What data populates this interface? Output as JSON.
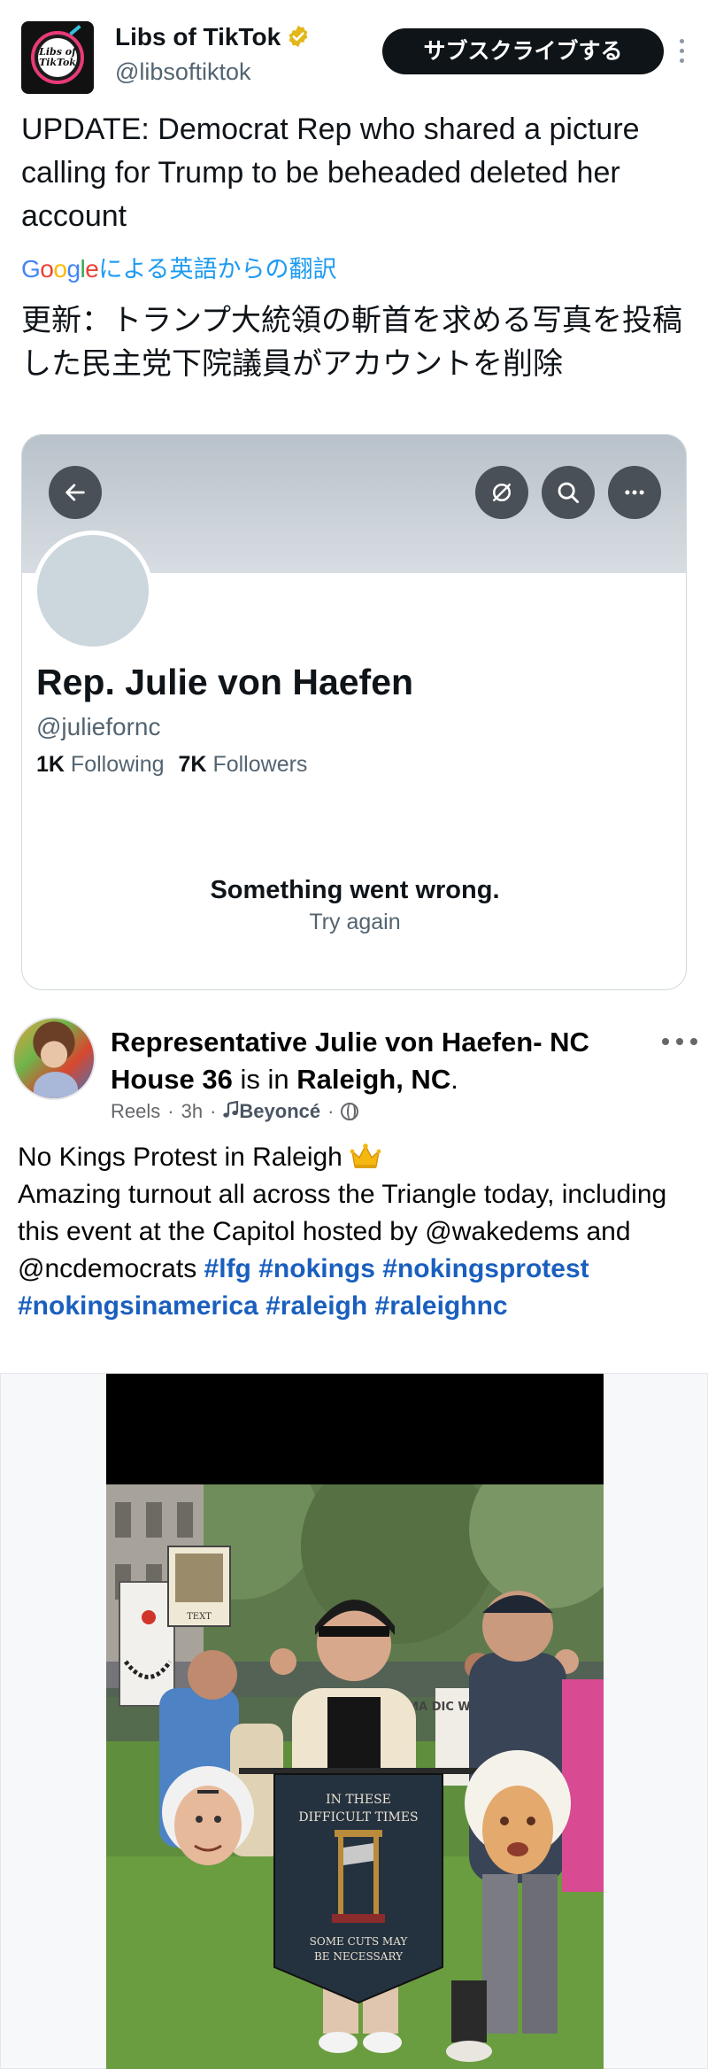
{
  "tweet": {
    "author_name": "Libs of TikTok",
    "author_handle": "@libsoftiktok",
    "avatar_text_line1": "Libs of",
    "avatar_text_line2": "TikTok",
    "subscribe_label": "サブスクライブする",
    "text": "UPDATE: Democrat Rep who shared a picture calling for Trump to be beheaded deleted her account",
    "translation": {
      "google_letters": [
        "G",
        "o",
        "o",
        "g",
        "l",
        "e"
      ],
      "label": "による英語からの翻訳",
      "text": "更新：トランプ大統領の斬首を求める写真を投稿した民主党下院議員がアカウントを削除"
    },
    "icons": [
      "verified-badge-icon",
      "more-vertical-icon"
    ]
  },
  "profile_card": {
    "name": "Rep. Julie von Haefen",
    "handle": "@juliefornc",
    "following_count": "1K",
    "following_label": "Following",
    "followers_count": "7K",
    "followers_label": "Followers",
    "error_title": "Something went wrong.",
    "error_retry": "Try again",
    "icons": [
      "back-arrow-icon",
      "notifications-off-icon",
      "search-icon",
      "more-horizontal-icon"
    ]
  },
  "facebook_post": {
    "author": "Representative Julie von Haefen- NC House 36",
    "is_in": "is in",
    "location": "Raleigh, NC",
    "period": ".",
    "meta_type": "Reels",
    "meta_time": "3h",
    "meta_music": "Beyoncé",
    "body_line1": "No Kings Protest in Raleigh",
    "body_text": "Amazing turnout all across the Triangle today, including this event at the Capitol hosted by @wakedems and @ncdemocrats",
    "hashtags": [
      "#lfg",
      "#nokings",
      "#nokingsprotest",
      "#nokingsinamerica",
      "#raleigh",
      "#raleighnc"
    ],
    "icons": [
      "crown-emoji-icon",
      "music-note-icon",
      "globe-icon",
      "more-horizontal-icon"
    ]
  },
  "video": {
    "banner_line1": "IN THESE",
    "banner_line2": "DIFFICULT TIMES",
    "banner_line3": "SOME CUTS MAY",
    "banner_line4": "BE NECESSARY",
    "sign_text": "MA DIC WA 40",
    "sign_top_text": "TEXT"
  },
  "colors": {
    "x_blue": "#1d9bf0",
    "verified_gold": "#e2b719",
    "fb_hashtag": "#1a5fbe",
    "subscribe_bg": "#0f1419"
  }
}
